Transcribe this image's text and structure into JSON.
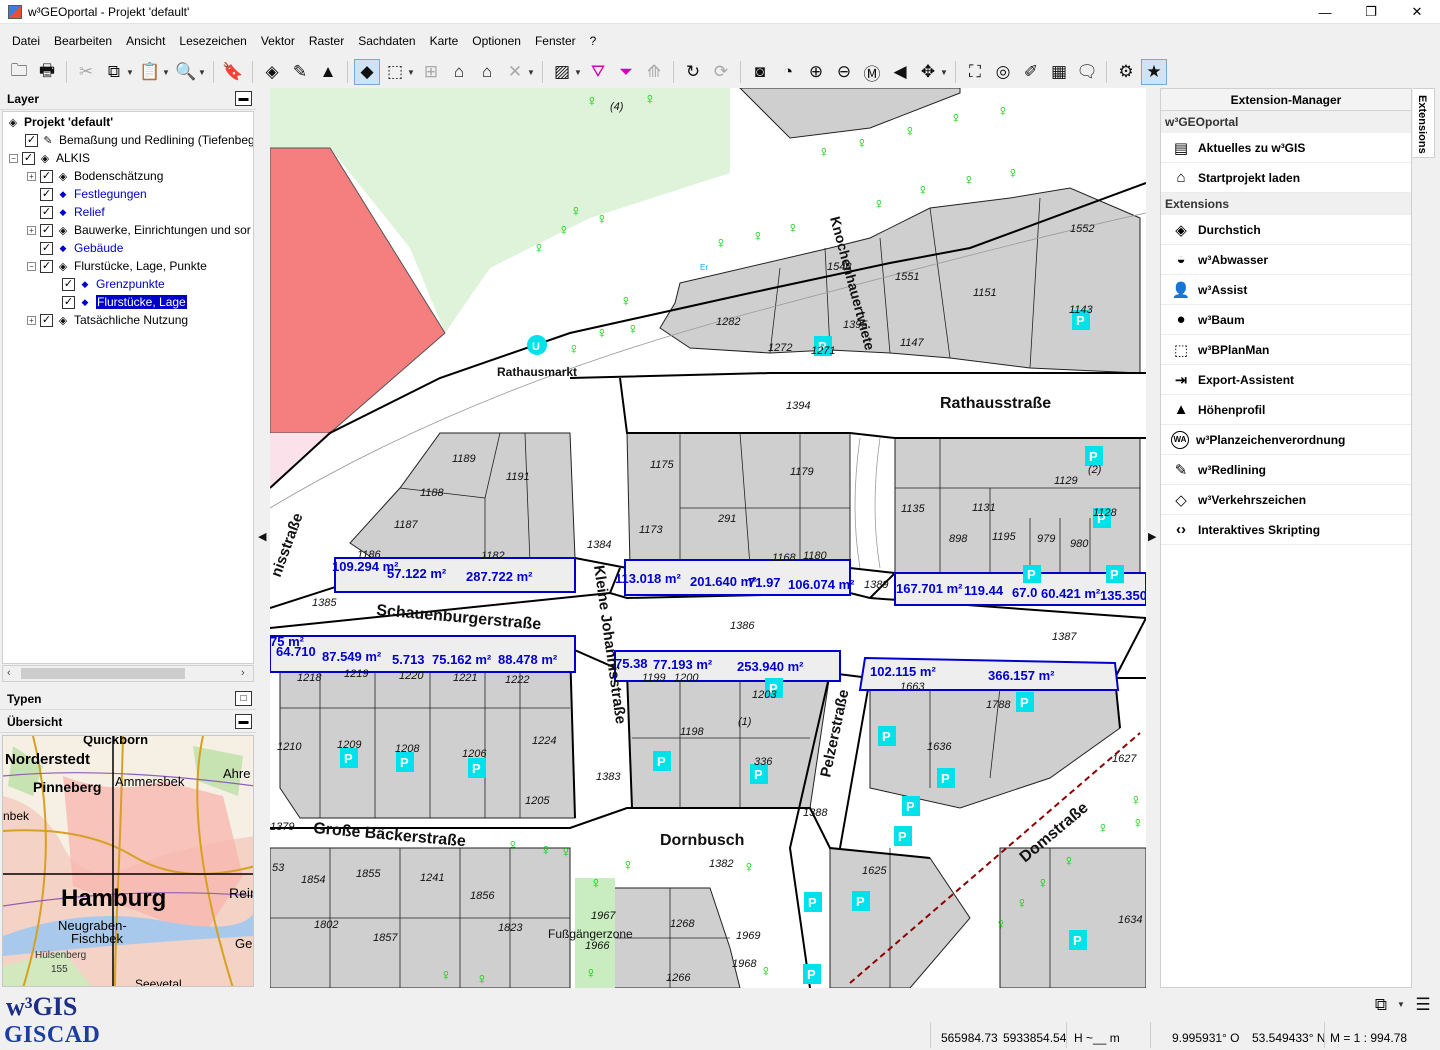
{
  "window": {
    "title": "w³GEOportal - Projekt 'default'",
    "controls": [
      "—",
      "❐",
      "✕"
    ]
  },
  "menu": [
    "Datei",
    "Bearbeiten",
    "Ansicht",
    "Lesezeichen",
    "Vektor",
    "Raster",
    "Sachdaten",
    "Karte",
    "Optionen",
    "Fenster",
    "?"
  ],
  "panels": {
    "layer_title": "Layer",
    "typen_title": "Typen",
    "uebersicht_title": "Übersicht"
  },
  "layers": [
    {
      "label": "Projekt 'default'"
    },
    {
      "label": "Bemaßung und Redlining (Tiefenbeg"
    },
    {
      "label": "ALKIS"
    },
    {
      "label": "Bodenschätzung"
    },
    {
      "label": "Festlegungen"
    },
    {
      "label": "Relief"
    },
    {
      "label": "Bauwerke, Einrichtungen und sor"
    },
    {
      "label": "Gebäude"
    },
    {
      "label": "Flurstücke, Lage, Punkte"
    },
    {
      "label": "Grenzpunkte"
    },
    {
      "label": "Flurstücke, Lage"
    },
    {
      "label": "Tatsächliche Nutzung"
    }
  ],
  "overview_labels": [
    "Quickborn",
    "Norderstedt",
    "Ammersbek",
    "Ahre",
    "Pinneberg",
    "nbek",
    "Hamburg",
    "Reir",
    "Neugraben-",
    "Fischbek",
    "Ge",
    "Hülsenberg",
    "155",
    "Seevetal"
  ],
  "map": {
    "streets": [
      "Rathausstraße",
      "Rathausmarkt",
      "Knochenhauertwiete",
      "Schauenburgerstraße",
      "Kleine Johannisstraße",
      "Große Bäckerstraße",
      "Dornbusch",
      "Pelzerstraße",
      "Domstraße",
      "nisstraße",
      "Fußgängerzone"
    ],
    "areas": [
      "109.294 m²",
      "57.122 m²",
      "287.722 m²",
      "113.018 m²",
      "201.640 m²",
      "71.97",
      "106.074 m²",
      "167.701 m²",
      "119.44",
      "67.0",
      "60.421 m²",
      "135.350",
      "75 m²",
      "64.710",
      "87.549 m²",
      "5.713",
      "75.162 m²",
      "88.478 m²",
      "75.38",
      "77.193 m²",
      "253.940 m²",
      "102.115 m²",
      "366.157 m²"
    ],
    "parcels": [
      "1552",
      "1548",
      "1551",
      "1151",
      "1143",
      "1282",
      "1272",
      "1271",
      "1395",
      "1147",
      "1394",
      "1189",
      "1191",
      "1188",
      "1187",
      "1186",
      "1182",
      "1175",
      "1179",
      "1173",
      "291",
      "1168",
      "1180",
      "1384",
      "1389",
      "1135",
      "1131",
      "1129",
      "1128",
      "898",
      "1195",
      "979",
      "980",
      "1385",
      "1386",
      "1387",
      "1218",
      "1219",
      "1220",
      "1221",
      "1222",
      "1199",
      "1200",
      "1203",
      "1663",
      "1788",
      "1210",
      "1209",
      "1208",
      "1206",
      "1224",
      "1205",
      "1198",
      "336",
      "1636",
      "1627",
      "1379",
      "1383",
      "1388",
      "1382",
      "1625",
      "53",
      "1854",
      "1855",
      "1241",
      "1856",
      "1802",
      "1857",
      "1823",
      "1967",
      "1966",
      "1268",
      "1969",
      "1968",
      "1266",
      "1634",
      "(4)",
      "(1)",
      "(2)"
    ],
    "symbols": [
      "U",
      "P",
      "Er"
    ]
  },
  "extension_manager": {
    "title": "Extension-Manager",
    "tab": "Extensions",
    "group1": "w³GEOportal",
    "group1_items": [
      {
        "label": "Aktuelles zu w³GIS",
        "icon": "news-icon"
      },
      {
        "label": "Startprojekt laden",
        "icon": "home-icon"
      }
    ],
    "group2": "Extensions",
    "group2_items": [
      {
        "label": "Durchstich",
        "icon": "layers-icon"
      },
      {
        "label": "w³Abwasser",
        "icon": "sewer-icon"
      },
      {
        "label": "w³Assist",
        "icon": "person-icon"
      },
      {
        "label": "w³Baum",
        "icon": "tree-icon"
      },
      {
        "label": "w³BPlanMan",
        "icon": "plan-frame-icon"
      },
      {
        "label": "Export-Assistent",
        "icon": "export-icon"
      },
      {
        "label": "Höhenprofil",
        "icon": "profile-icon"
      },
      {
        "label": "w³Planzeichenverordnung",
        "icon": "wa-icon"
      },
      {
        "label": "w³Redlining",
        "icon": "pen-icon"
      },
      {
        "label": "w³Verkehrszeichen",
        "icon": "traffic-sign-icon"
      },
      {
        "label": "Interaktives Skripting",
        "icon": "code-icon"
      }
    ]
  },
  "status": {
    "logo_top": "w³GIS",
    "logo_bottom": "GISCAD",
    "x": "565984.73",
    "y": "5933854.54",
    "h": "H ~__ m",
    "lon": "9.995931° O",
    "lat": "53.549433° N",
    "scale": "M = 1 : 994.78"
  },
  "colors": {
    "parcel_fill": "#cfcfcf",
    "building_red": "#f57f7f",
    "green_area": "#dff3da",
    "area_label": "#0000cc",
    "parking": "#00e1ea",
    "tree": "#00d200"
  }
}
